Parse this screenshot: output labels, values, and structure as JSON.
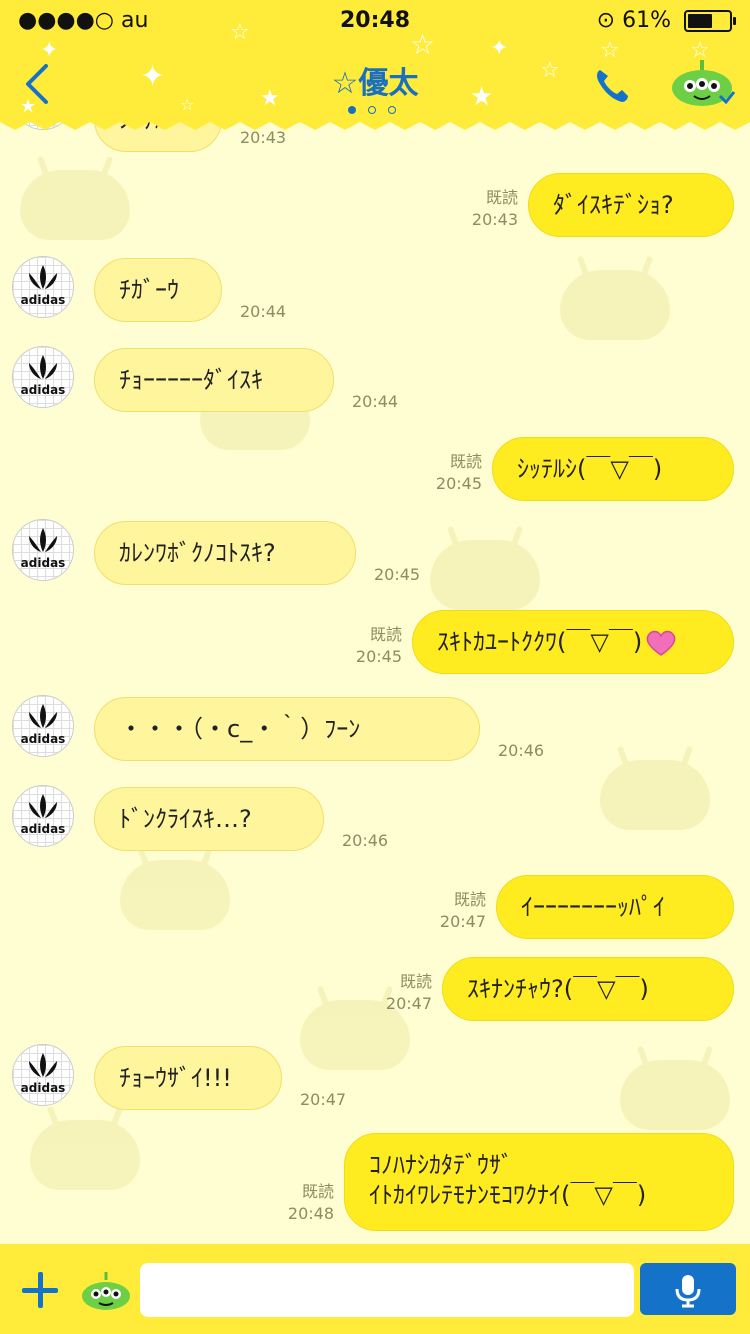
{
  "status_bar": {
    "carrier": "●●●●○ au",
    "time": "20:48",
    "battery": "61%",
    "battery_level": 0.61
  },
  "header": {
    "title": "☆優太"
  },
  "read_label": "既読",
  "avatar_text": "adidas",
  "messages": [
    {
      "side": "in",
      "text": "ｼｯﾃﾙ",
      "time": "20:43"
    },
    {
      "side": "out",
      "text": "ﾀﾞｲｽｷﾃﾞｼｮ?",
      "time": "20:43",
      "read": "既読"
    },
    {
      "side": "in",
      "text": "ﾁｶﾞｰｳ",
      "time": "20:44"
    },
    {
      "side": "in",
      "text": "ﾁｮｰｰｰｰｰﾀﾞｲｽｷ",
      "time": "20:44"
    },
    {
      "side": "out",
      "text": "ｼｯﾃﾙｼ(￣▽￣)",
      "time": "20:45",
      "read": "既読"
    },
    {
      "side": "in",
      "text": "ｶﾚﾝﾜﾎﾞｸﾉｺﾄｽｷ?",
      "time": "20:45"
    },
    {
      "side": "out",
      "text": "ｽｷﾄｶﾕｰﾄｸｸﾜ(￣▽￣)",
      "time": "20:45",
      "read": "既読"
    },
    {
      "side": "in",
      "text": "・・・（・c_・｀）ﾌｰﾝ",
      "time": "20:46"
    },
    {
      "side": "in",
      "text": "ﾄﾞﾝｸﾗｲｽｷ…?",
      "time": "20:46"
    },
    {
      "side": "out",
      "text": "ｲｰｰｰｰｰｰｰｯﾊﾟｲ",
      "time": "20:47",
      "read": "既読"
    },
    {
      "side": "out",
      "text": "ｽｷﾅﾝﾁｬｳ?(￣▽￣)",
      "time": "20:47",
      "read": "既読"
    },
    {
      "side": "in",
      "text": "ﾁｮｰｳｻﾞｲ!!!",
      "time": "20:47"
    },
    {
      "side": "out",
      "text": "ｺﾉﾊﾅｼｶﾀﾃﾞｳｻﾞ\nｲﾄｶｲﾜﾚﾃﾓﾅﾝﾓｺﾜｸﾅｲ(￣▽￣)",
      "time": "20:48",
      "read": "既読"
    }
  ],
  "footer": {
    "input_value": ""
  },
  "colors": {
    "accent": "#1473c9",
    "bar": "#ffec3a",
    "background": "#fffdd2",
    "bubble_out": "#ffec20",
    "bubble_in": "#fff59c"
  },
  "icons": {
    "back": "chevron-left-icon",
    "call": "phone-icon",
    "mic": "microphone-icon",
    "plus": "plus-icon"
  }
}
